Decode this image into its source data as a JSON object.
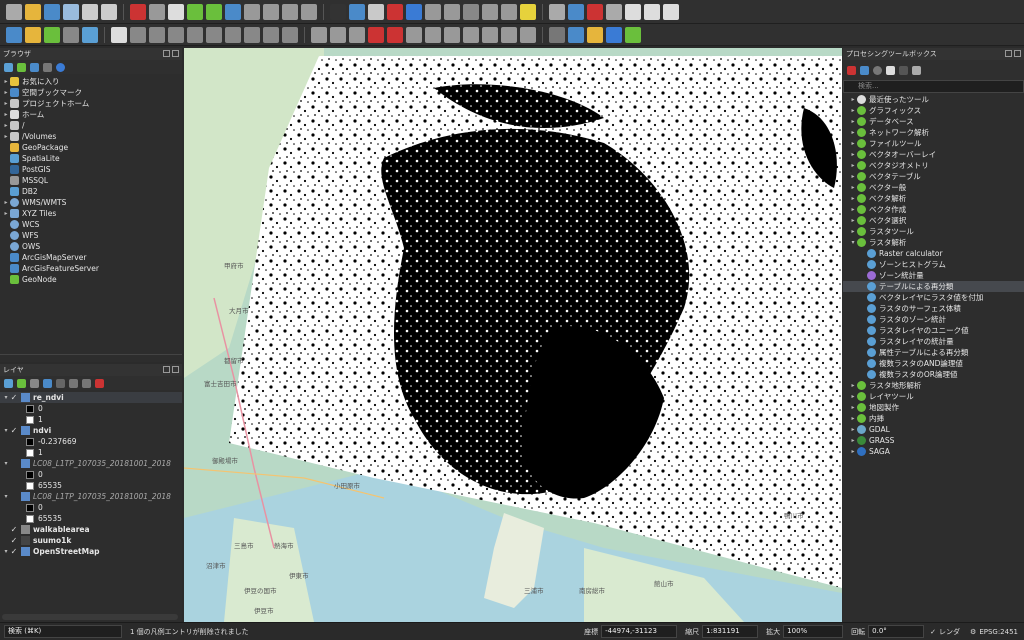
{
  "browser": {
    "title": "ブラウザ",
    "items": [
      {
        "label": "お気に入り",
        "icon": "star-icon",
        "expand": "▸"
      },
      {
        "label": "空間ブックマーク",
        "icon": "bookmark-icon",
        "expand": "▸"
      },
      {
        "label": "プロジェクトホーム",
        "icon": "folder-icon",
        "expand": "▸"
      },
      {
        "label": "ホーム",
        "icon": "home-icon",
        "expand": "▸"
      },
      {
        "label": "/",
        "icon": "folder-icon",
        "expand": "▸"
      },
      {
        "label": "/Volumes",
        "icon": "folder-icon",
        "expand": "▸"
      },
      {
        "label": "GeoPackage",
        "icon": "geopackage-icon",
        "expand": ""
      },
      {
        "label": "SpatiaLite",
        "icon": "spatialite-icon",
        "expand": ""
      },
      {
        "label": "PostGIS",
        "icon": "postgis-icon",
        "expand": ""
      },
      {
        "label": "MSSQL",
        "icon": "mssql-icon",
        "expand": ""
      },
      {
        "label": "DB2",
        "icon": "db2-icon",
        "expand": ""
      },
      {
        "label": "WMS/WMTS",
        "icon": "globe-icon",
        "expand": "▸"
      },
      {
        "label": "XYZ Tiles",
        "icon": "tiles-icon",
        "expand": "▸"
      },
      {
        "label": "WCS",
        "icon": "globe-icon",
        "expand": ""
      },
      {
        "label": "WFS",
        "icon": "globe-icon",
        "expand": ""
      },
      {
        "label": "OWS",
        "icon": "globe-icon",
        "expand": ""
      },
      {
        "label": "ArcGisMapServer",
        "icon": "arcgis-icon",
        "expand": ""
      },
      {
        "label": "ArcGisFeatureServer",
        "icon": "arcgis-icon",
        "expand": ""
      },
      {
        "label": "GeoNode",
        "icon": "geonode-icon",
        "expand": ""
      }
    ]
  },
  "layers": {
    "title": "レイヤ",
    "rows": [
      {
        "type": "layer",
        "label": "re_ndvi",
        "check": "✓",
        "style": "bold"
      },
      {
        "type": "legend",
        "label": "0",
        "color": "#000000"
      },
      {
        "type": "legend",
        "label": "1",
        "color": "#ffffff"
      },
      {
        "type": "layer",
        "label": "ndvi",
        "check": "✓",
        "style": "bold"
      },
      {
        "type": "legend",
        "label": "-0.237669",
        "color": "#000000"
      },
      {
        "type": "legend",
        "label": "1",
        "color": "#ffffff"
      },
      {
        "type": "layer",
        "label": "LC08_L1TP_107035_20181001_2018",
        "check": "",
        "style": "italic"
      },
      {
        "type": "legend",
        "label": "0",
        "color": "#000000"
      },
      {
        "type": "legend",
        "label": "65535",
        "color": "#ffffff"
      },
      {
        "type": "layer",
        "label": "LC08_L1TP_107035_20181001_2018",
        "check": "",
        "style": "italic"
      },
      {
        "type": "legend",
        "label": "0",
        "color": "#000000"
      },
      {
        "type": "legend",
        "label": "65535",
        "color": "#ffffff"
      },
      {
        "type": "vector",
        "label": "walkablearea",
        "check": "✓",
        "style": "bold",
        "color": "#888888"
      },
      {
        "type": "vector",
        "label": "suumo1k",
        "check": "✓",
        "style": "bold",
        "color": "#444444"
      },
      {
        "type": "layer",
        "label": "OpenStreetMap",
        "check": "✓",
        "style": "bold"
      }
    ]
  },
  "processing": {
    "title": "プロセシングツールボックス",
    "search_placeholder": "検索...",
    "items": [
      {
        "label": "最近使ったツール",
        "level": 0,
        "expand": "▸",
        "icon": "clock-icon"
      },
      {
        "label": "グラフィックス",
        "level": 0,
        "expand": "▸",
        "icon": "qgis-algorithm-icon"
      },
      {
        "label": "データベース",
        "level": 0,
        "expand": "▸",
        "icon": "qgis-algorithm-icon"
      },
      {
        "label": "ネットワーク解析",
        "level": 0,
        "expand": "▸",
        "icon": "qgis-algorithm-icon"
      },
      {
        "label": "ファイルツール",
        "level": 0,
        "expand": "▸",
        "icon": "qgis-algorithm-icon"
      },
      {
        "label": "ベクタオーバーレイ",
        "level": 0,
        "expand": "▸",
        "icon": "qgis-algorithm-icon"
      },
      {
        "label": "ベクタジオメトリ",
        "level": 0,
        "expand": "▸",
        "icon": "qgis-algorithm-icon"
      },
      {
        "label": "ベクタテーブル",
        "level": 0,
        "expand": "▸",
        "icon": "qgis-algorithm-icon"
      },
      {
        "label": "ベクター般",
        "level": 0,
        "expand": "▸",
        "icon": "qgis-algorithm-icon"
      },
      {
        "label": "ベクタ解析",
        "level": 0,
        "expand": "▸",
        "icon": "qgis-algorithm-icon"
      },
      {
        "label": "ベクタ作成",
        "level": 0,
        "expand": "▸",
        "icon": "qgis-algorithm-icon"
      },
      {
        "label": "ベクタ選択",
        "level": 0,
        "expand": "▸",
        "icon": "qgis-algorithm-icon"
      },
      {
        "label": "ラスタツール",
        "level": 0,
        "expand": "▸",
        "icon": "qgis-algorithm-icon"
      },
      {
        "label": "ラスタ解析",
        "level": 0,
        "expand": "▾",
        "icon": "qgis-algorithm-icon"
      },
      {
        "label": "Raster calculator",
        "level": 1,
        "expand": "",
        "icon": "gear-icon"
      },
      {
        "label": "ゾーンヒストグラム",
        "level": 1,
        "expand": "",
        "icon": "gear-icon"
      },
      {
        "label": "ゾーン統計量",
        "level": 1,
        "expand": "",
        "icon": "zonal-icon"
      },
      {
        "label": "テーブルによる再分類",
        "level": 1,
        "expand": "",
        "icon": "gear-icon",
        "selected": true
      },
      {
        "label": "ベクタレイヤにラスタ値を付加",
        "level": 1,
        "expand": "",
        "icon": "gear-icon"
      },
      {
        "label": "ラスタのサーフェス体積",
        "level": 1,
        "expand": "",
        "icon": "gear-icon"
      },
      {
        "label": "ラスタのゾーン統計",
        "level": 1,
        "expand": "",
        "icon": "gear-icon"
      },
      {
        "label": "ラスタレイヤのユニーク値",
        "level": 1,
        "expand": "",
        "icon": "gear-icon"
      },
      {
        "label": "ラスタレイヤの統計量",
        "level": 1,
        "expand": "",
        "icon": "gear-icon"
      },
      {
        "label": "属性テーブルによる再分類",
        "level": 1,
        "expand": "",
        "icon": "gear-icon"
      },
      {
        "label": "複数ラスタのAND論理値",
        "level": 1,
        "expand": "",
        "icon": "gear-icon"
      },
      {
        "label": "複数ラスタのOR論理値",
        "level": 1,
        "expand": "",
        "icon": "gear-icon"
      },
      {
        "label": "ラスタ地形解析",
        "level": 0,
        "expand": "▸",
        "icon": "qgis-algorithm-icon"
      },
      {
        "label": "レイヤツール",
        "level": 0,
        "expand": "▸",
        "icon": "qgis-algorithm-icon"
      },
      {
        "label": "地図製作",
        "level": 0,
        "expand": "▸",
        "icon": "qgis-algorithm-icon"
      },
      {
        "label": "内挿",
        "level": 0,
        "expand": "▸",
        "icon": "qgis-algorithm-icon"
      },
      {
        "label": "GDAL",
        "level": 0,
        "expand": "▸",
        "icon": "gdal-icon"
      },
      {
        "label": "GRASS",
        "level": 0,
        "expand": "▸",
        "icon": "grass-icon"
      },
      {
        "label": "SAGA",
        "level": 0,
        "expand": "▸",
        "icon": "saga-icon"
      }
    ]
  },
  "map": {
    "place_labels": [
      "甲府市",
      "大月市",
      "都留市",
      "富士吉田市",
      "御殿場市",
      "小田原市",
      "沼津市",
      "三島市",
      "伊東市",
      "熱海市",
      "伊豆の国市",
      "三浦市",
      "南房総市",
      "館山市",
      "伊豆市",
      "鴨川市"
    ]
  },
  "status": {
    "search_placeholder": "検索 (⌘K)",
    "message": "1 個の凡例エントリが削除されました",
    "coord_label": "座標",
    "coord_value": "-44974,-31123",
    "scale_label": "縮尺",
    "scale_value": "1:831191",
    "magnifier_label": "拡大",
    "magnifier_value": "100%",
    "rotation_label": "回転",
    "rotation_value": "0.0°",
    "render_label": "レンダ",
    "crs": "EPSG:2451"
  },
  "colors": {
    "accent": "#5a9fd4",
    "qgis_green": "#6abf3c",
    "dark_bg": "#2b2b2b"
  }
}
